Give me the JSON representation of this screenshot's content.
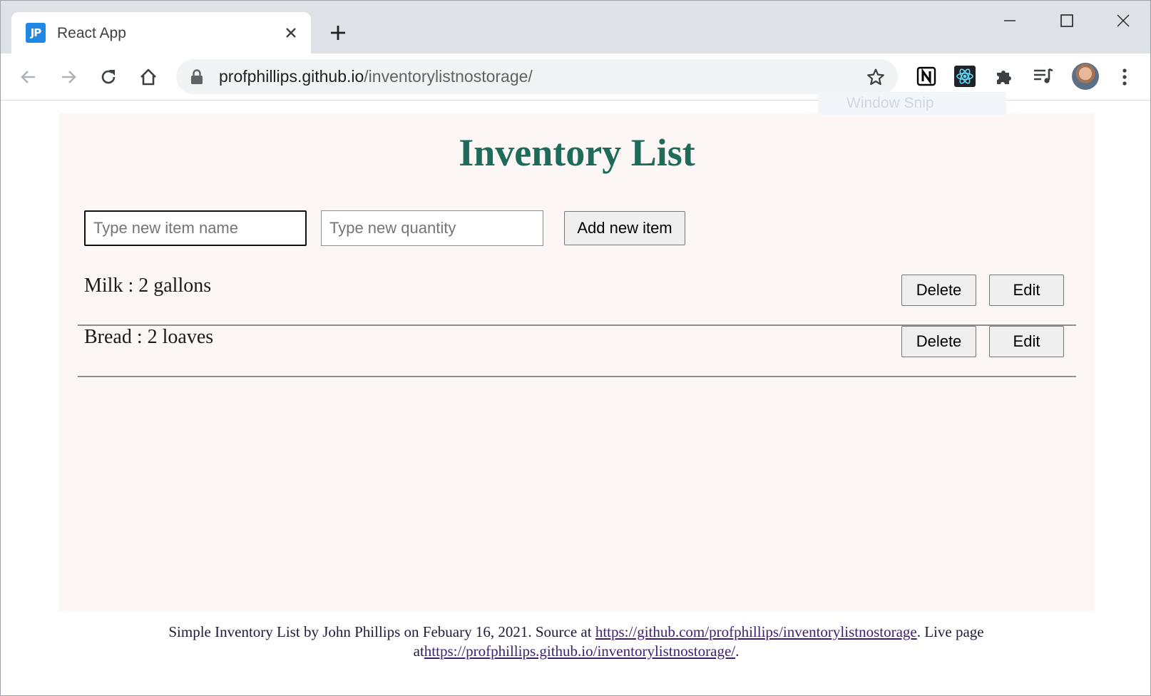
{
  "browser": {
    "tab": {
      "favicon_text": "JP",
      "title": "React App"
    },
    "address": {
      "host": "profphillips.github.io",
      "path": "/inventorylistnostorage/"
    },
    "overlay_text": "Window Snip",
    "icons": [
      "back-icon",
      "forward-icon",
      "reload-icon",
      "home-icon",
      "lock-icon",
      "star-icon",
      "notion-extension-icon",
      "react-devtools-icon",
      "extensions-puzzle-icon",
      "media-queue-icon",
      "profile-avatar",
      "kebab-menu-icon",
      "minimize-icon",
      "maximize-icon",
      "close-icon",
      "new-tab-icon"
    ]
  },
  "app": {
    "title": "Inventory List",
    "name_input": {
      "placeholder": "Type new item name",
      "value": ""
    },
    "qty_input": {
      "placeholder": "Type new quantity",
      "value": ""
    },
    "add_label": "Add new item",
    "items": [
      {
        "text": "Milk : 2 gallons",
        "delete_label": "Delete",
        "edit_label": "Edit"
      },
      {
        "text": "Bread : 2 loaves",
        "delete_label": "Delete",
        "edit_label": "Edit"
      }
    ]
  },
  "footer": {
    "line1_prefix": "Simple Inventory List by John Phillips on Febuary 16, 2021. Source at ",
    "source_link": "https://github.com/profphillips/inventorylistnostorage",
    "line1_suffix": ". Live page",
    "line2_prefix": "at",
    "live_link": "https://profphillips.github.io/inventorylistnostorage/",
    "line2_suffix": "."
  },
  "colors": {
    "title": "#1e6b5a",
    "page_bg": "#fcf7f5",
    "chrome_bg": "#dee1e6"
  }
}
